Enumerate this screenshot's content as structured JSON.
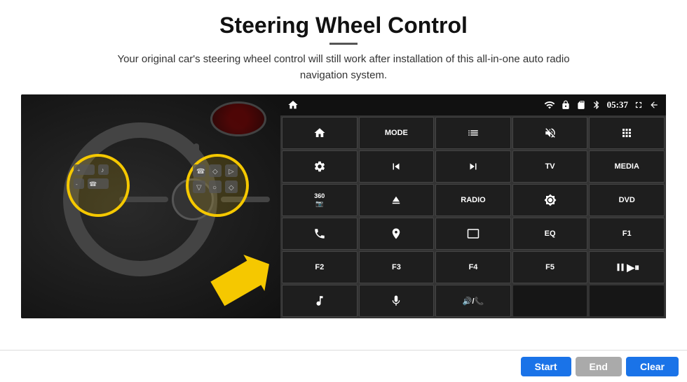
{
  "page": {
    "title": "Steering Wheel Control",
    "subtitle": "Your original car's steering wheel control will still work after installation of this all-in-one auto radio navigation system.",
    "underline": true
  },
  "status_bar": {
    "time": "05:37",
    "icons": [
      "home",
      "wifi",
      "lock",
      "sd-card",
      "bluetooth",
      "clock",
      "fullscreen",
      "back"
    ]
  },
  "control_buttons": [
    {
      "id": "home-icon",
      "type": "icon",
      "icon": "home",
      "row": 1
    },
    {
      "id": "mode-btn",
      "type": "text",
      "label": "MODE",
      "row": 1
    },
    {
      "id": "list-icon",
      "type": "icon",
      "icon": "list",
      "row": 1
    },
    {
      "id": "mute-icon",
      "type": "icon",
      "icon": "volume-mute",
      "row": 1
    },
    {
      "id": "apps-icon",
      "type": "icon",
      "icon": "apps",
      "row": 1
    },
    {
      "id": "settings-icon",
      "type": "icon",
      "icon": "settings",
      "row": 2
    },
    {
      "id": "prev-icon",
      "type": "icon",
      "icon": "skip-prev",
      "row": 2
    },
    {
      "id": "next-icon",
      "type": "icon",
      "icon": "skip-next",
      "row": 2
    },
    {
      "id": "tv-btn",
      "type": "text",
      "label": "TV",
      "row": 2
    },
    {
      "id": "media-btn",
      "type": "text",
      "label": "MEDIA",
      "row": 2
    },
    {
      "id": "cam360-icon",
      "type": "icon",
      "icon": "360cam",
      "row": 3
    },
    {
      "id": "eject-icon",
      "type": "icon",
      "icon": "eject",
      "row": 3
    },
    {
      "id": "radio-btn",
      "type": "text",
      "label": "RADIO",
      "row": 3
    },
    {
      "id": "brightness-icon",
      "type": "icon",
      "icon": "brightness",
      "row": 3
    },
    {
      "id": "dvd-btn",
      "type": "text",
      "label": "DVD",
      "row": 3
    },
    {
      "id": "phone-icon",
      "type": "icon",
      "icon": "phone",
      "row": 4
    },
    {
      "id": "nav-icon",
      "type": "icon",
      "icon": "navigation",
      "row": 4
    },
    {
      "id": "screen-icon",
      "type": "icon",
      "icon": "screen",
      "row": 4
    },
    {
      "id": "eq-btn",
      "type": "text",
      "label": "EQ",
      "row": 4
    },
    {
      "id": "f1-btn",
      "type": "text",
      "label": "F1",
      "row": 4
    },
    {
      "id": "f2-btn",
      "type": "text",
      "label": "F2",
      "row": 5
    },
    {
      "id": "f3-btn",
      "type": "text",
      "label": "F3",
      "row": 5
    },
    {
      "id": "f4-btn",
      "type": "text",
      "label": "F4",
      "row": 5
    },
    {
      "id": "f5-btn",
      "type": "text",
      "label": "F5",
      "row": 5
    },
    {
      "id": "playpause-icon",
      "type": "icon",
      "icon": "play-pause",
      "row": 5
    },
    {
      "id": "music-icon",
      "type": "icon",
      "icon": "music",
      "row": 6
    },
    {
      "id": "mic-icon",
      "type": "icon",
      "icon": "microphone",
      "row": 6
    },
    {
      "id": "vol-phone-icon",
      "type": "icon",
      "icon": "vol-phone",
      "row": 6
    },
    {
      "id": "empty1",
      "type": "empty",
      "label": "",
      "row": 6
    },
    {
      "id": "empty2",
      "type": "empty",
      "label": "",
      "row": 6
    }
  ],
  "bottom_bar": {
    "start_label": "Start",
    "end_label": "End",
    "clear_label": "Clear"
  }
}
